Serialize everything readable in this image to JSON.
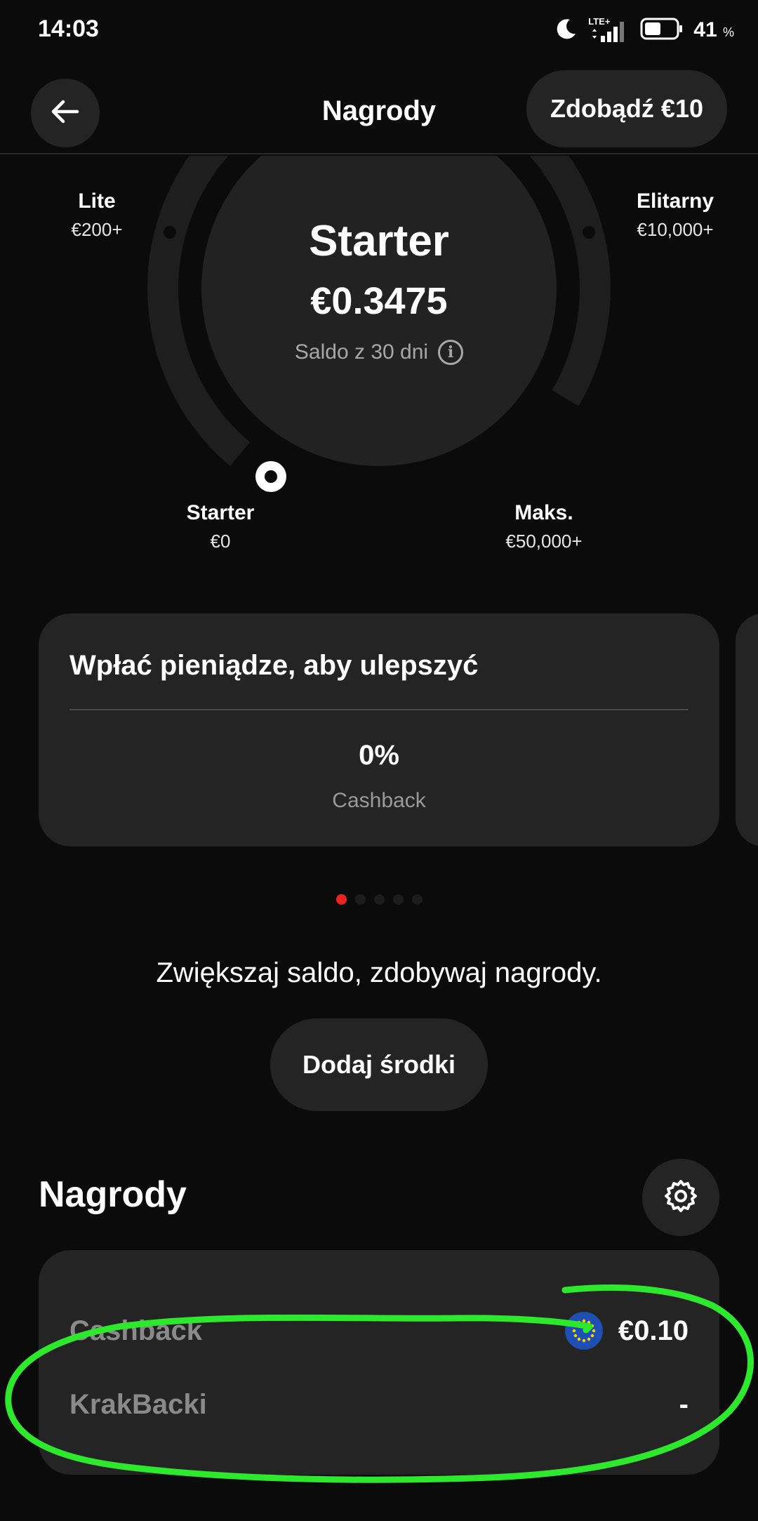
{
  "status_bar": {
    "time": "14:03",
    "network": "LTE+",
    "battery_percent": "41",
    "percent_sign": "%",
    "icons": [
      "moon-icon",
      "signal-icon",
      "battery-icon"
    ]
  },
  "header": {
    "title": "Nagrody",
    "earn_button": "Zdobądź €10",
    "back_icon": "arrow-left-icon"
  },
  "tier": {
    "current_name": "Starter",
    "balance": "€0.3475",
    "balance_caption": "Saldo z 30 dni",
    "info_glyph": "i",
    "levels": [
      {
        "name": "Lite",
        "threshold": "€200+"
      },
      {
        "name": "Elitarny",
        "threshold": "€10,000+"
      },
      {
        "name": "Starter",
        "threshold": "€0"
      },
      {
        "name": "Maks.",
        "threshold": "€50,000+"
      }
    ],
    "current_level_index": 2
  },
  "upgrade_card": {
    "title": "Wpłać pieniądze, aby ulepszyć",
    "value": "0%",
    "label": "Cashback"
  },
  "pager": {
    "count": 5,
    "active_index": 0,
    "active_color": "#e8251e"
  },
  "promo": {
    "text": "Zwiększaj saldo, zdobywaj nagrody.",
    "button": "Dodaj środki"
  },
  "rewards": {
    "heading": "Nagrody",
    "settings_icon": "gear-icon",
    "rows": [
      {
        "label": "Cashback",
        "value": "€0.10",
        "icon": "eu-flag-icon"
      },
      {
        "label": "KrakBacki",
        "value": "-"
      }
    ]
  },
  "annotation_color": "#2ee82e",
  "colors": {
    "background": "#0b0b0b",
    "card": "#242424",
    "accent": "#e8251e"
  }
}
